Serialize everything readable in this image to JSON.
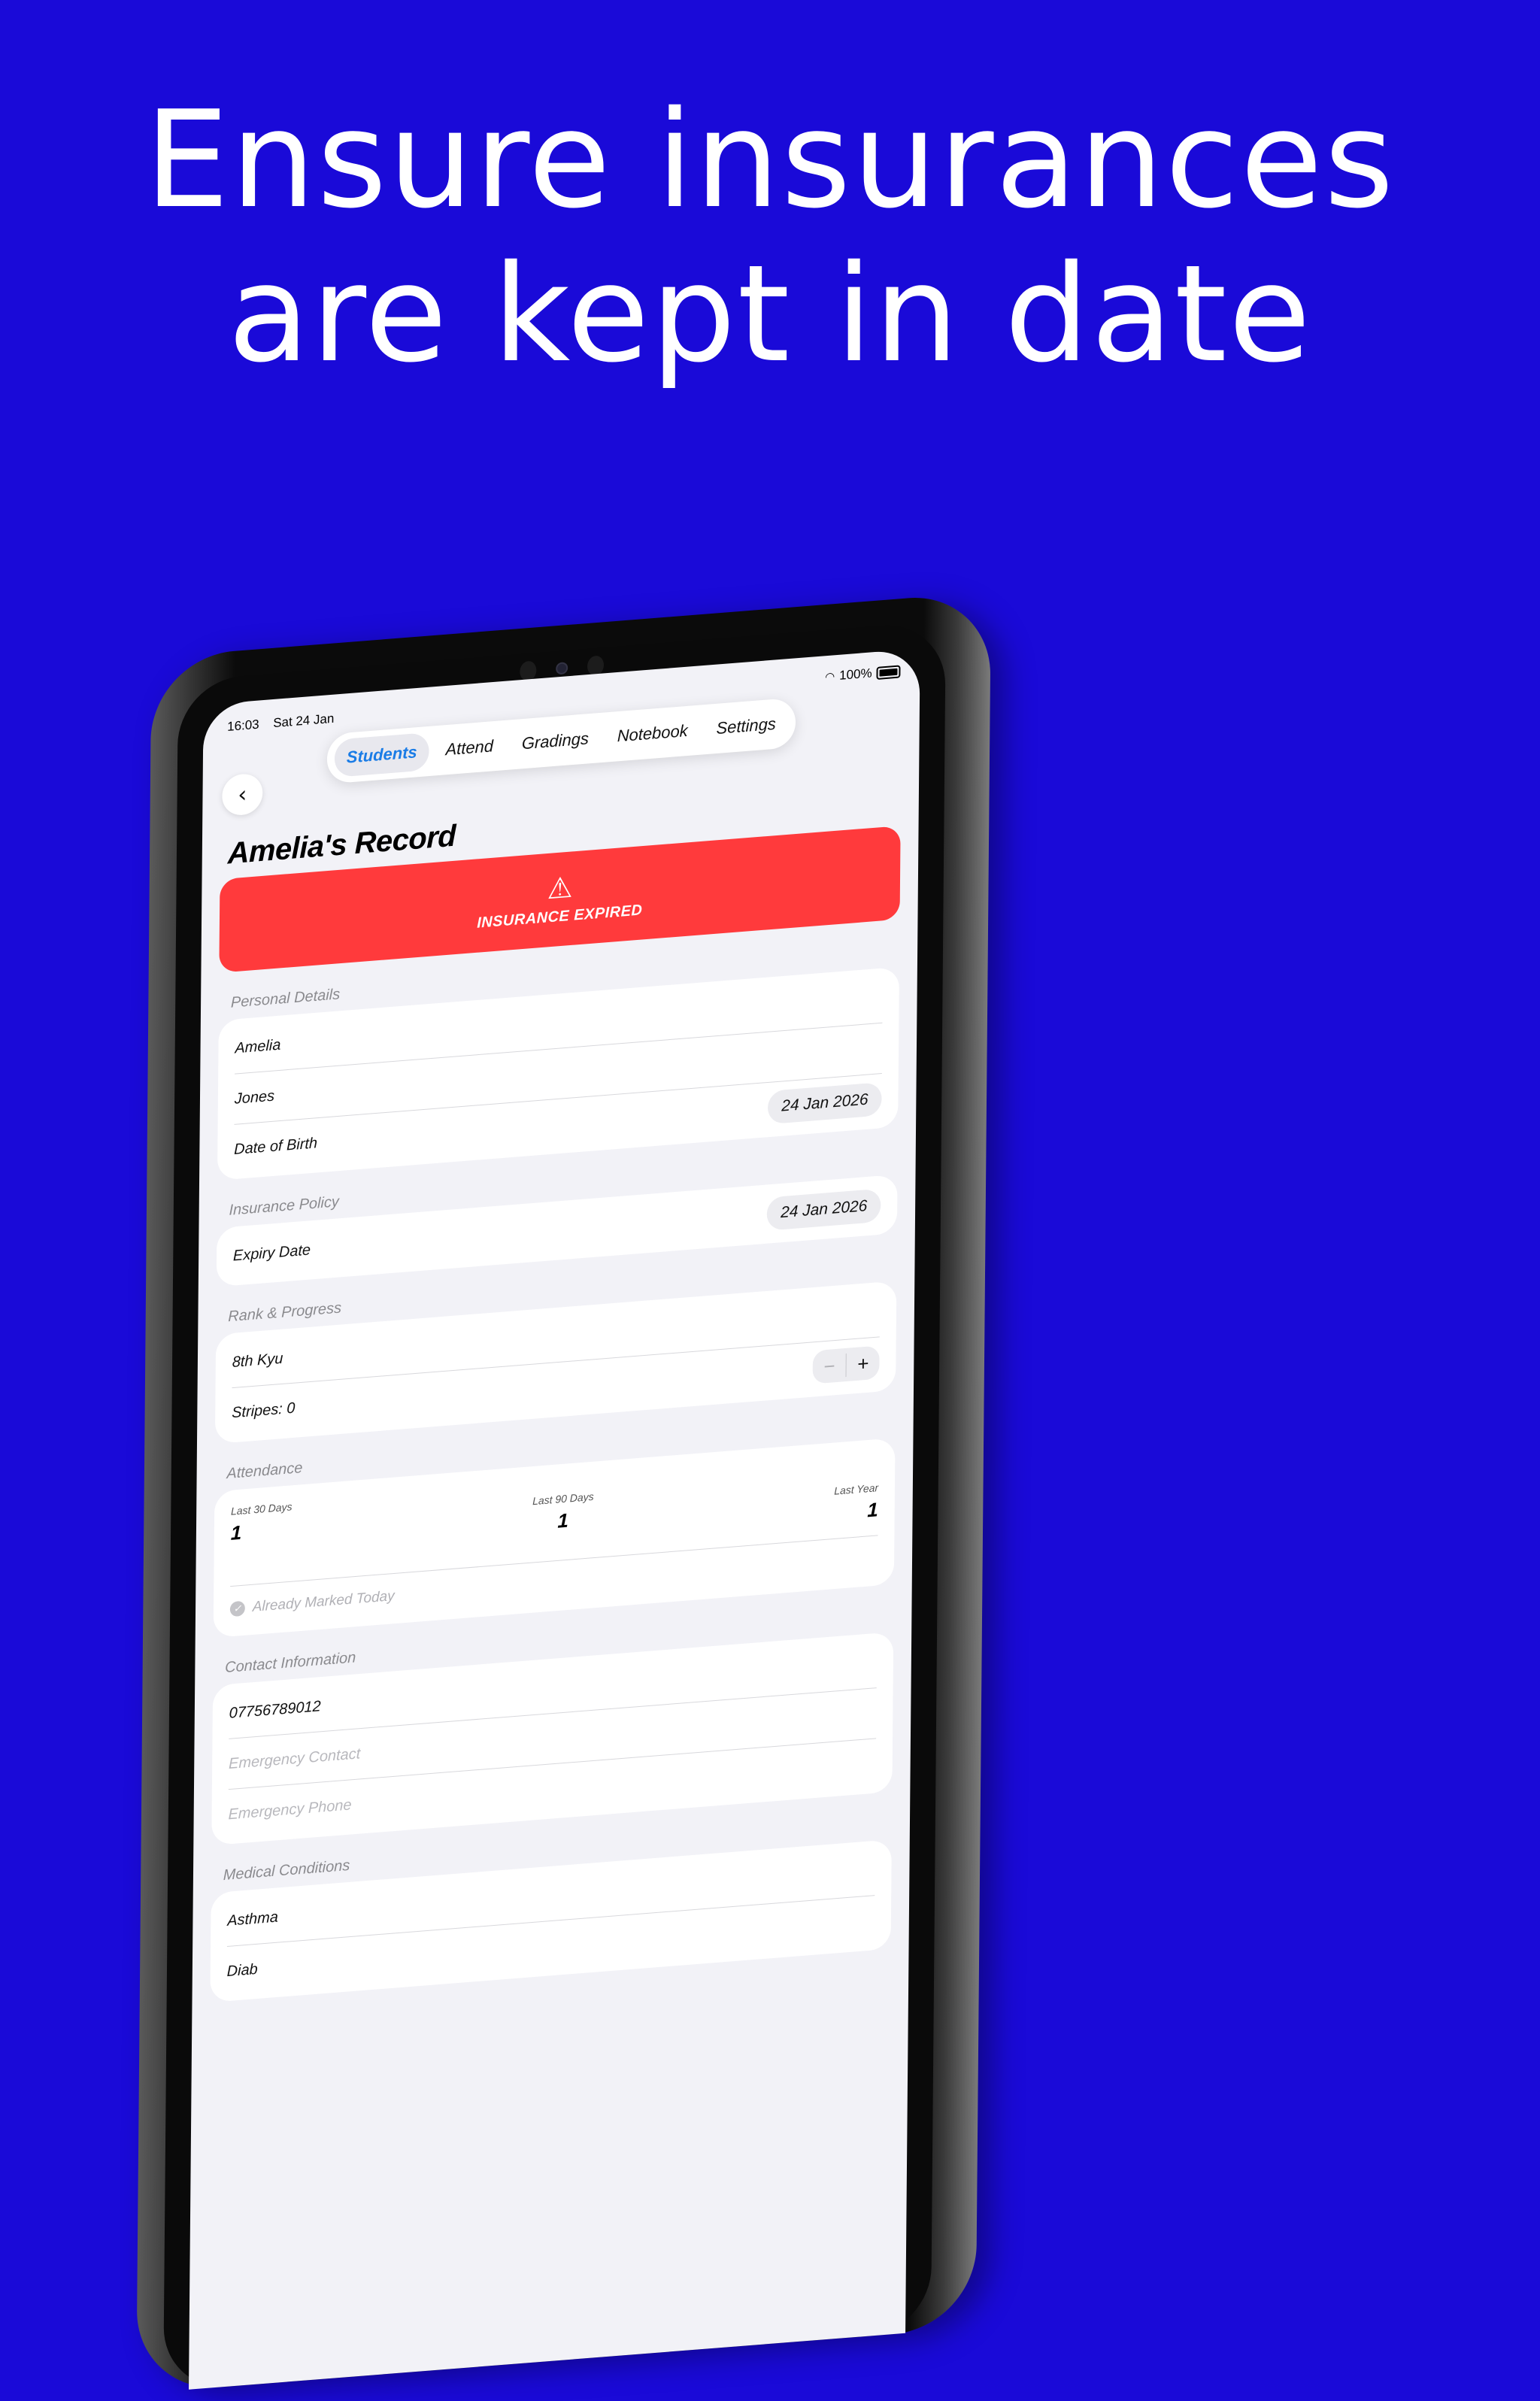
{
  "headline": {
    "line1": "Ensure insurances",
    "line2": "are kept in date"
  },
  "status_bar": {
    "time": "16:03",
    "date": "Sat 24 Jan",
    "battery": "100%",
    "wifi_icon": "wifi-icon",
    "battery_icon": "battery-icon"
  },
  "tabs": [
    {
      "label": "Students",
      "active": true
    },
    {
      "label": "Attend",
      "active": false
    },
    {
      "label": "Gradings",
      "active": false
    },
    {
      "label": "Notebook",
      "active": false
    },
    {
      "label": "Settings",
      "active": false
    }
  ],
  "page": {
    "title": "Amelia's Record",
    "back_icon": "chevron-left-icon"
  },
  "alert": {
    "text": "INSURANCE EXPIRED",
    "icon": "warning-icon",
    "color": "#ff3a3c"
  },
  "personal_details": {
    "label": "Personal Details",
    "first_name": "Amelia",
    "last_name": "Jones",
    "dob_label": "Date of Birth",
    "dob_value": "24 Jan 2026"
  },
  "insurance_policy": {
    "label": "Insurance Policy",
    "expiry_label": "Expiry Date",
    "expiry_value": "24 Jan 2026"
  },
  "rank_progress": {
    "label": "Rank & Progress",
    "rank": "8th Kyu",
    "stripes_label": "Stripes: 0",
    "minus": "−",
    "plus": "+"
  },
  "attendance": {
    "label": "Attendance",
    "last_30_label": "Last 30 Days",
    "last_30_value": "1",
    "last_90_label": "Last 90 Days",
    "last_90_value": "1",
    "last_year_label": "Last Year",
    "last_year_value": "1",
    "marked_text": "Already Marked Today"
  },
  "contact": {
    "label": "Contact Information",
    "phone": "07756789012",
    "emergency_contact_placeholder": "Emergency Contact",
    "emergency_phone_placeholder": "Emergency Phone"
  },
  "medical": {
    "label": "Medical Conditions",
    "item1": "Asthma",
    "item2": "Diab"
  },
  "colors": {
    "background": "#1a0ad8",
    "accent": "#1a7ce6",
    "alert": "#ff3a3c"
  }
}
